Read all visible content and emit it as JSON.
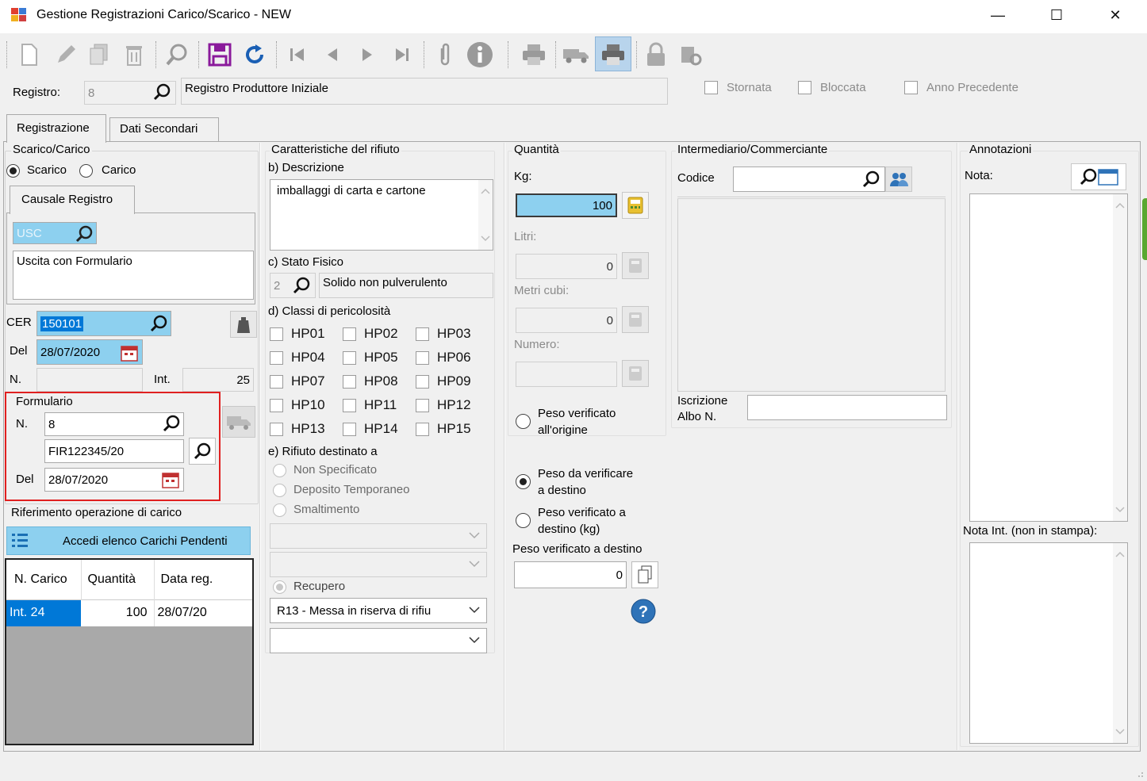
{
  "window": {
    "title": "Gestione Registrazioni Carico/Scarico - NEW",
    "minimize": "—",
    "maximize": "☐",
    "close": "✕"
  },
  "toolbar": {
    "icons": [
      "new-document-icon",
      "edit-icon",
      "copy-icon",
      "delete-icon",
      "search-icon",
      "save-icon",
      "refresh-icon",
      "first-record-icon",
      "previous-record-icon",
      "next-record-icon",
      "last-record-icon",
      "attachment-icon",
      "info-icon",
      "print-icon",
      "truck-icon",
      "print-active-icon",
      "lock-icon",
      "settings-icon"
    ]
  },
  "registro": {
    "label": "Registro:",
    "code": "8",
    "description": "Registro Produttore Iniziale",
    "checks": [
      "Stornata",
      "Bloccata",
      "Anno Precedente"
    ]
  },
  "tabs": [
    "Registrazione",
    "Dati Secondari"
  ],
  "scarico_carico": {
    "title": "Scarico/Carico",
    "scarico": "Scarico",
    "carico": "Carico",
    "causale_tab": "Causale Registro",
    "causale_code": "USC",
    "causale_desc": "Uscita con Formulario",
    "cer_label": "CER",
    "cer_value": "150101",
    "del_label": "Del",
    "del_value": "28/07/2020",
    "n_label": "N.",
    "int_label": "Int.",
    "int_value": "25"
  },
  "formulario": {
    "title": "Formulario",
    "n_label": "N.",
    "n_value": "8",
    "fir_value": "FIR122345/20",
    "del_label": "Del",
    "del_value": "28/07/2020"
  },
  "riferimento": {
    "title": "Riferimento operazione di carico",
    "button": "Accedi elenco Carichi Pendenti",
    "columns": [
      "N. Carico",
      "Quantità",
      "Data reg."
    ],
    "rows": [
      [
        "Int. 24",
        "100",
        "28/07/20"
      ]
    ]
  },
  "caratteristiche": {
    "title": "Caratteristiche del rifiuto",
    "descrizione_label": "b) Descrizione",
    "descrizione_value": "imballaggi di carta e cartone",
    "stato_label": "c) Stato Fisico",
    "stato_code": "2",
    "stato_value": "Solido non pulverulento",
    "classi_label": "d) Classi di pericolosità",
    "hp": [
      [
        "HP01",
        "HP02",
        "HP03"
      ],
      [
        "HP04",
        "HP05",
        "HP06"
      ],
      [
        "HP07",
        "HP08",
        "HP09"
      ],
      [
        "HP10",
        "HP11",
        "HP12"
      ],
      [
        "HP13",
        "HP14",
        "HP15"
      ]
    ],
    "destinato_label": "e) Rifiuto destinato a",
    "destinato_options": [
      "Non Specificato",
      "Deposito Temporaneo",
      "Smaltimento"
    ],
    "recupero_label": "Recupero",
    "recupero_value": "R13 - Messa in riserva di rifiu"
  },
  "quantita": {
    "title": "Quantità",
    "kg_label": "Kg:",
    "kg_value": "100",
    "litri_label": "Litri:",
    "litri_value": "0",
    "metri_label": "Metri cubi:",
    "metri_value": "0",
    "numero_label": "Numero:",
    "peso_origine_1": "Peso verificato",
    "peso_origine_2": "all'origine",
    "peso_dest_1": "Peso da verificare",
    "peso_dest_2": "a destino",
    "peso_ver_1": "Peso verificato a",
    "peso_ver_2": "destino (kg)",
    "peso_ver_label": "Peso verificato a destino",
    "peso_ver_value": "0"
  },
  "intermediario": {
    "title": "Intermediario/Commerciante",
    "codice_label": "Codice",
    "iscrizione_1": "Iscrizione",
    "iscrizione_2": "Albo N."
  },
  "annotazioni": {
    "title": "Annotazioni",
    "nota_label": "Nota:",
    "nota_int_label": "Nota Int. (non in stampa):"
  },
  "colors": {
    "highlight_blue": "#8dd0ef",
    "selection_blue": "#0078d7",
    "red_border": "#e02020",
    "save_purple": "#8a1a9b",
    "refresh_blue": "#1a5fb4"
  }
}
